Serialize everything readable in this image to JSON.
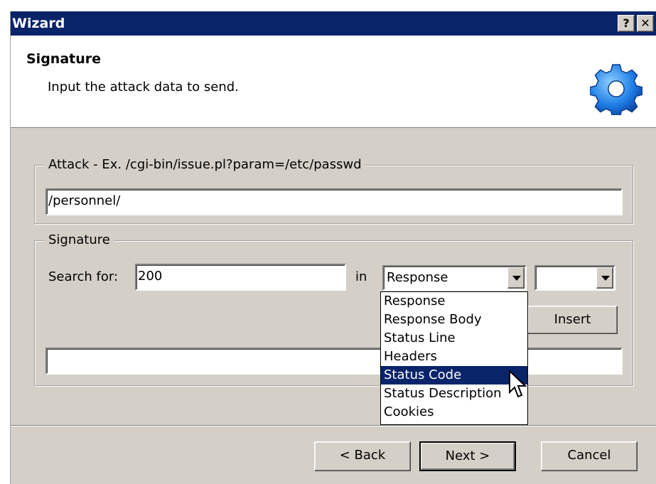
{
  "window": {
    "title": "Wizard",
    "help_button": "?",
    "close_button": "✕"
  },
  "header": {
    "title": "Signature",
    "subtitle": "Input the attack data to send.",
    "icon": "gear-icon",
    "icon_color": "#1f6fd6"
  },
  "attack": {
    "legend": "Attack - Ex. /cgi-bin/issue.pl?param=/etc/passwd",
    "value": "/personnel/"
  },
  "signature": {
    "legend": "Signature",
    "search_label": "Search for:",
    "search_value": "200",
    "in_label": "in",
    "in_selected": "Response",
    "second_selected": "",
    "insert_label": "Insert",
    "expression_value": ""
  },
  "dropdown": {
    "options": [
      "Response",
      "Response Body",
      "Status Line",
      "Headers",
      "Status Code",
      "Status Description",
      "Cookies"
    ],
    "highlighted": "Status Code"
  },
  "footer": {
    "back_label": "< Back",
    "next_label": "Next >",
    "cancel_label": "Cancel"
  },
  "colors": {
    "titlebar": "#0a246a",
    "dialog_bg": "#d4d0c8",
    "selection": "#0a246a"
  }
}
